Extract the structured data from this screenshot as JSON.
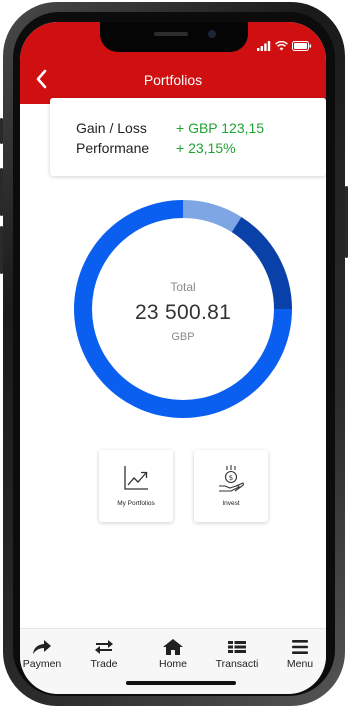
{
  "header": {
    "title": "Portfolios"
  },
  "summary": {
    "gain_label": "Gain / Loss",
    "gain_value": "+ GBP 123,15",
    "performance_label": "Performane",
    "performance_value": "+ 23,15%"
  },
  "total": {
    "label": "Total",
    "amount": "23 500.81",
    "currency": "GBP"
  },
  "donut_segments": [
    {
      "color": "#0a5ff0",
      "share": 0.75
    },
    {
      "color": "#7ea6e4",
      "share": 0.09
    },
    {
      "color": "#0941a8",
      "share": 0.16
    }
  ],
  "actions": {
    "portfolios_label": "My Portfolios",
    "invest_label": "Invest"
  },
  "tabs": [
    {
      "label": "Paymen",
      "icon": "share-arrow-icon"
    },
    {
      "label": "Trade",
      "icon": "swap-arrows-icon"
    },
    {
      "label": "Home",
      "icon": "home-icon"
    },
    {
      "label": "Transacti",
      "icon": "list-icon"
    },
    {
      "label": "Menu",
      "icon": "hamburger-icon"
    }
  ],
  "colors": {
    "brand": "#cf0f10",
    "positive": "#21a432"
  }
}
